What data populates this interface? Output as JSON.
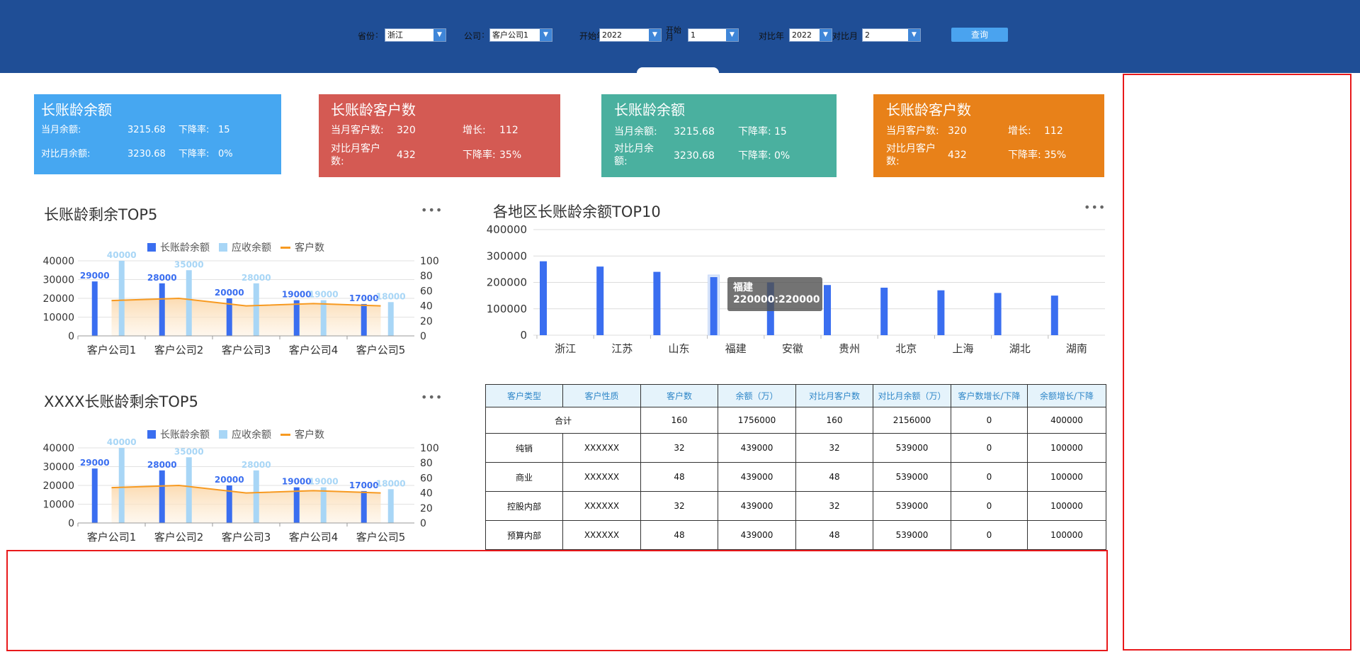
{
  "filters": {
    "province_label": "省份",
    "province_value": "浙江",
    "company_label": "公司",
    "company_value": "客户公司1",
    "start_year_label": "开始年",
    "start_year_value": "2022",
    "start_month_label": "开始月",
    "start_month_value": "1",
    "cmp_year_label": "对比年",
    "cmp_year_value": "2022",
    "cmp_month_label": "对比月",
    "cmp_month_value": "2",
    "query_label": "查询"
  },
  "cards": [
    {
      "title": "长账龄余额",
      "l1": "当月余额:",
      "v1": "3215.68",
      "l2": "下降率:",
      "v2": "15",
      "l3": "对比月余额:",
      "v3": "3230.68",
      "l4": "下降率:",
      "v4": "0%",
      "color": "#46a7f1"
    },
    {
      "title": "长账龄客户数",
      "l1": "当月客户数:",
      "v1": "320",
      "l2": "增长:",
      "v2": "112",
      "l3": "对比月客户数:",
      "v3": "432",
      "l4": "下降率:",
      "v4": "35%",
      "color": "#d45a53"
    },
    {
      "title": "长账龄余额",
      "l1": "当月余额:",
      "v1": "3215.68",
      "l2": "下降率:",
      "v2": "15",
      "l3": "对比月余额:",
      "v3": "3230.68",
      "l4": "下降率:",
      "v4": "0%",
      "color": "#4ab09f"
    },
    {
      "title": "长账龄客户数",
      "l1": "当月客户数:",
      "v1": "320",
      "l2": "增长:",
      "v2": "112",
      "l3": "对比月客户数:",
      "v3": "432",
      "l4": "下降率:",
      "v4": "35%",
      "color": "#e88119"
    }
  ],
  "panels": {
    "top5_title": "长账龄剩余TOP5",
    "xxxx_title": "XXXX长账龄剩余TOP5",
    "region_title": "各地区长账龄余额TOP10",
    "more": "•••"
  },
  "legend": {
    "s1": "长账龄余额",
    "s2": "应收余额",
    "s3": "客户数"
  },
  "tooltip": {
    "name": "福建",
    "value": "220000:220000"
  },
  "chart_data": [
    {
      "type": "bar",
      "title": "长账龄剩余TOP5",
      "categories": [
        "客户公司1",
        "客户公司2",
        "客户公司3",
        "客户公司4",
        "客户公司5"
      ],
      "series": [
        {
          "name": "长账龄余额",
          "values": [
            29000,
            28000,
            20000,
            19000,
            17000
          ]
        },
        {
          "name": "应收余额",
          "values": [
            40000,
            35000,
            28000,
            19000,
            18000
          ]
        },
        {
          "name": "客户数",
          "type": "line",
          "axis": "right",
          "values": [
            47,
            50,
            40,
            43,
            40
          ]
        }
      ],
      "ylim": [
        0,
        40000
      ],
      "y2lim": [
        0,
        100
      ],
      "yticks": [
        "0",
        "10000",
        "20000",
        "30000",
        "40000"
      ],
      "y2ticks": [
        "0",
        "20",
        "40",
        "60",
        "80",
        "100"
      ]
    },
    {
      "type": "bar",
      "title": "XXXX长账龄剩余TOP5",
      "categories": [
        "客户公司1",
        "客户公司2",
        "客户公司3",
        "客户公司4",
        "客户公司5"
      ],
      "series": [
        {
          "name": "长账龄余额",
          "values": [
            29000,
            28000,
            20000,
            19000,
            17000
          ]
        },
        {
          "name": "应收余额",
          "values": [
            40000,
            35000,
            28000,
            19000,
            18000
          ]
        },
        {
          "name": "客户数",
          "type": "line",
          "axis": "right",
          "values": [
            47,
            50,
            40,
            43,
            40
          ]
        }
      ],
      "ylim": [
        0,
        40000
      ],
      "y2lim": [
        0,
        100
      ],
      "yticks": [
        "0",
        "10000",
        "20000",
        "30000",
        "40000"
      ],
      "y2ticks": [
        "0",
        "20",
        "40",
        "60",
        "80",
        "100"
      ]
    },
    {
      "type": "bar",
      "title": "各地区长账龄余额TOP10",
      "categories": [
        "浙江",
        "江苏",
        "山东",
        "福建",
        "安徽",
        "贵州",
        "北京",
        "上海",
        "湖北",
        "湖南"
      ],
      "values": [
        280000,
        260000,
        240000,
        220000,
        200000,
        190000,
        180000,
        170000,
        160000,
        150000
      ],
      "ylim": [
        0,
        400000
      ],
      "yticks": [
        "0",
        "100000",
        "200000",
        "300000",
        "400000"
      ]
    }
  ],
  "table": {
    "headers": [
      "客户类型",
      "客户性质",
      "客户数",
      "余额（万）",
      "对比月客户数",
      "对比月余额（万）",
      "客户数增长/下降",
      "余额增长/下降"
    ],
    "total": {
      "label": "合计",
      "cells": [
        "160",
        "1756000",
        "160",
        "2156000",
        "0",
        "400000"
      ]
    },
    "rows": [
      [
        "纯销",
        "XXXXXX",
        "32",
        "439000",
        "32",
        "539000",
        "0",
        "100000"
      ],
      [
        "商业",
        "XXXXXX",
        "48",
        "439000",
        "48",
        "539000",
        "0",
        "100000"
      ],
      [
        "控股内部",
        "XXXXXX",
        "32",
        "439000",
        "32",
        "539000",
        "0",
        "100000"
      ],
      [
        "预算内部",
        "XXXXXX",
        "48",
        "439000",
        "48",
        "539000",
        "0",
        "100000"
      ]
    ]
  },
  "colors": {
    "bar1": "#3a6ef0",
    "bar2": "#a8d6f6",
    "line": "#f79a21",
    "region_bar": "#3a6ef0"
  }
}
